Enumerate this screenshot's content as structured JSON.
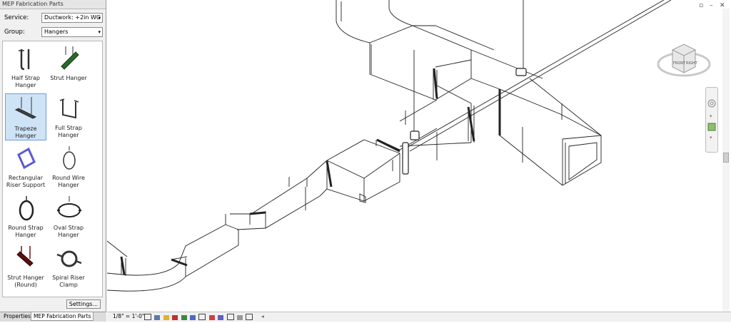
{
  "panel": {
    "title": "MEP Fabrication Parts",
    "service_label": "Service:",
    "service_value": "Ductwork: +2in WG",
    "group_label": "Group:",
    "group_value": "Hangers",
    "settings_label": "Settings...",
    "tiles": [
      {
        "label": "Half Strap Hanger",
        "icon": "half-strap-hanger-icon"
      },
      {
        "label": "Strut Hanger",
        "icon": "strut-hanger-icon"
      },
      {
        "label": "Trapeze Hanger",
        "icon": "trapeze-hanger-icon",
        "selected": true
      },
      {
        "label": "Full Strap Hanger",
        "icon": "full-strap-hanger-icon"
      },
      {
        "label": "Rectangular Riser Support",
        "icon": "rectangular-riser-support-icon"
      },
      {
        "label": "Round Wire Hanger",
        "icon": "round-wire-hanger-icon"
      },
      {
        "label": "Round Strap Hanger",
        "icon": "round-strap-hanger-icon"
      },
      {
        "label": "Oval Strap Hanger",
        "icon": "oval-strap-hanger-icon"
      },
      {
        "label": "Strut Hanger (Round)",
        "icon": "strut-hanger-round-icon"
      },
      {
        "label": "Spiral Riser Clamp",
        "icon": "spiral-riser-clamp-icon"
      }
    ]
  },
  "tabs": [
    "Properties",
    "MEP Fabrication Parts"
  ],
  "status": {
    "scale": "1/8\" = 1'-0\""
  },
  "viewcube": {
    "face_left": "FRONT",
    "face_right": "RIGHT"
  },
  "colors": {
    "selection": "#cfe3f7",
    "strut_green": "#2a6a2a",
    "riser_blue": "#5a5ad8"
  }
}
